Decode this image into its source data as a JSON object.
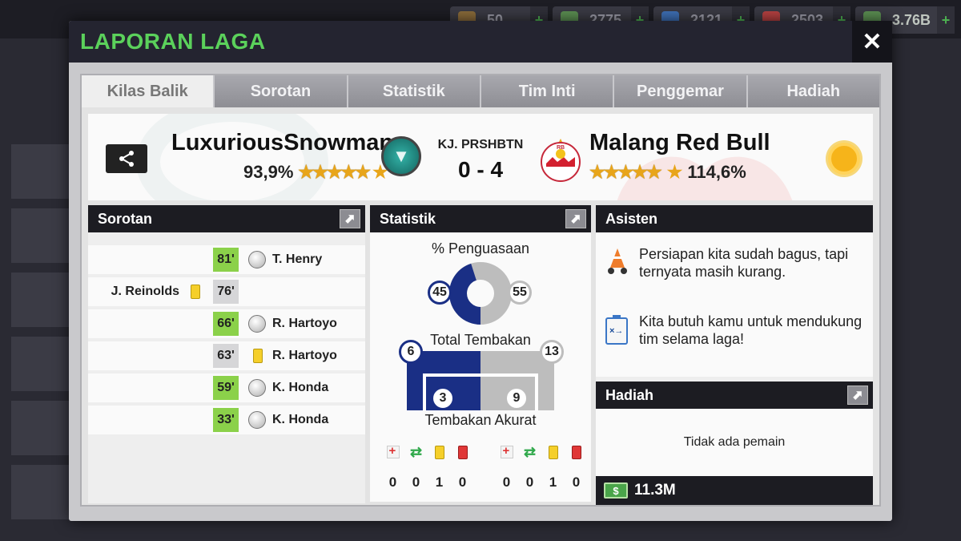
{
  "background": {
    "resources": [
      {
        "icon": "token-icon",
        "value": "50"
      },
      {
        "icon": "cash-icon",
        "value": "2775"
      },
      {
        "icon": "energy-icon",
        "value": "2121"
      },
      {
        "icon": "medkit-icon",
        "value": "2503"
      },
      {
        "icon": "money-icon",
        "value": "3.76B"
      }
    ]
  },
  "modal": {
    "title": "LAPORAN LAGA",
    "close_label": "✕"
  },
  "tabs": [
    {
      "label": "Kilas Balik",
      "active": true
    },
    {
      "label": "Sorotan",
      "active": false
    },
    {
      "label": "Statistik",
      "active": false
    },
    {
      "label": "Tim Inti",
      "active": false
    },
    {
      "label": "Penggemar",
      "active": false
    },
    {
      "label": "Hadiah",
      "active": false
    }
  ],
  "match": {
    "home_team": "LuxuriousSnowman",
    "home_rating": "93,9%",
    "competition": "KJ. PRSHBTN",
    "score": "0 - 4",
    "away_team": "Malang Red Bull",
    "away_rating": "114,6%",
    "weather_icon": "sun-icon"
  },
  "highlights": {
    "title": "Sorotan",
    "rows": [
      {
        "minute": "81'",
        "side": "right",
        "event": "goal",
        "player": "T. Henry"
      },
      {
        "minute": "76'",
        "side": "left",
        "event": "yellow-card",
        "player": "J. Reinolds"
      },
      {
        "minute": "66'",
        "side": "right",
        "event": "goal",
        "player": "R. Hartoyo"
      },
      {
        "minute": "63'",
        "side": "right",
        "event": "yellow-card",
        "player": "R. Hartoyo"
      },
      {
        "minute": "59'",
        "side": "right",
        "event": "goal",
        "player": "K. Honda"
      },
      {
        "minute": "33'",
        "side": "right",
        "event": "goal",
        "player": "K. Honda"
      }
    ]
  },
  "stats": {
    "title": "Statistik",
    "possession_label": "% Penguasaan",
    "possession_home": "45",
    "possession_away": "55",
    "shots_label": "Total Tembakan",
    "shots_home": "6",
    "shots_away": "13",
    "on_target_label": "Tembakan Akurat",
    "on_target_home": "3",
    "on_target_away": "9",
    "home_counts": [
      "0",
      "0",
      "1",
      "0"
    ],
    "away_counts": [
      "0",
      "0",
      "1",
      "0"
    ],
    "colors": {
      "home": "#1a2f85",
      "away": "#bdbdbd"
    }
  },
  "assistant": {
    "title": "Asisten",
    "message_1": "Persiapan kita sudah bagus, tapi ternyata masih kurang.",
    "message_2": "Kita butuh kamu untuk mendukung tim selama laga!"
  },
  "rewards": {
    "title": "Hadiah",
    "empty_text": "Tidak ada pemain",
    "money": "11.3M"
  }
}
